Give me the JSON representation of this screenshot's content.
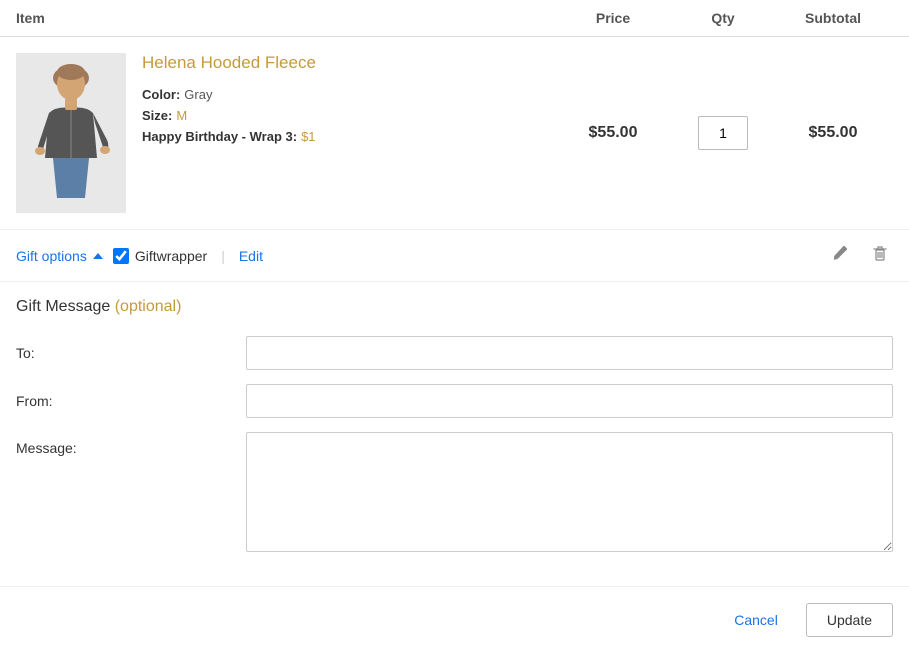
{
  "header": {
    "col_item": "Item",
    "col_price": "Price",
    "col_qty": "Qty",
    "col_subtotal": "Subtotal"
  },
  "item": {
    "name": "Helena Hooded Fleece",
    "price": "$55.00",
    "qty": "1",
    "subtotal": "$55.00",
    "color_label": "Color:",
    "color_value": "Gray",
    "size_label": "Size:",
    "size_value": "M",
    "wrap_label": "Happy Birthday - Wrap 3:",
    "wrap_value": "$1"
  },
  "gift_options": {
    "toggle_label": "Gift options",
    "giftwrapper_label": "Giftwrapper",
    "edit_label": "Edit"
  },
  "gift_message": {
    "title": "Gift Message",
    "optional_text": "(optional)",
    "to_label": "To:",
    "from_label": "From:",
    "message_label": "Message:",
    "to_value": "",
    "from_value": "",
    "message_value": ""
  },
  "footer": {
    "cancel_label": "Cancel",
    "update_label": "Update"
  },
  "icons": {
    "pencil": "✏",
    "trash": "🗑"
  }
}
